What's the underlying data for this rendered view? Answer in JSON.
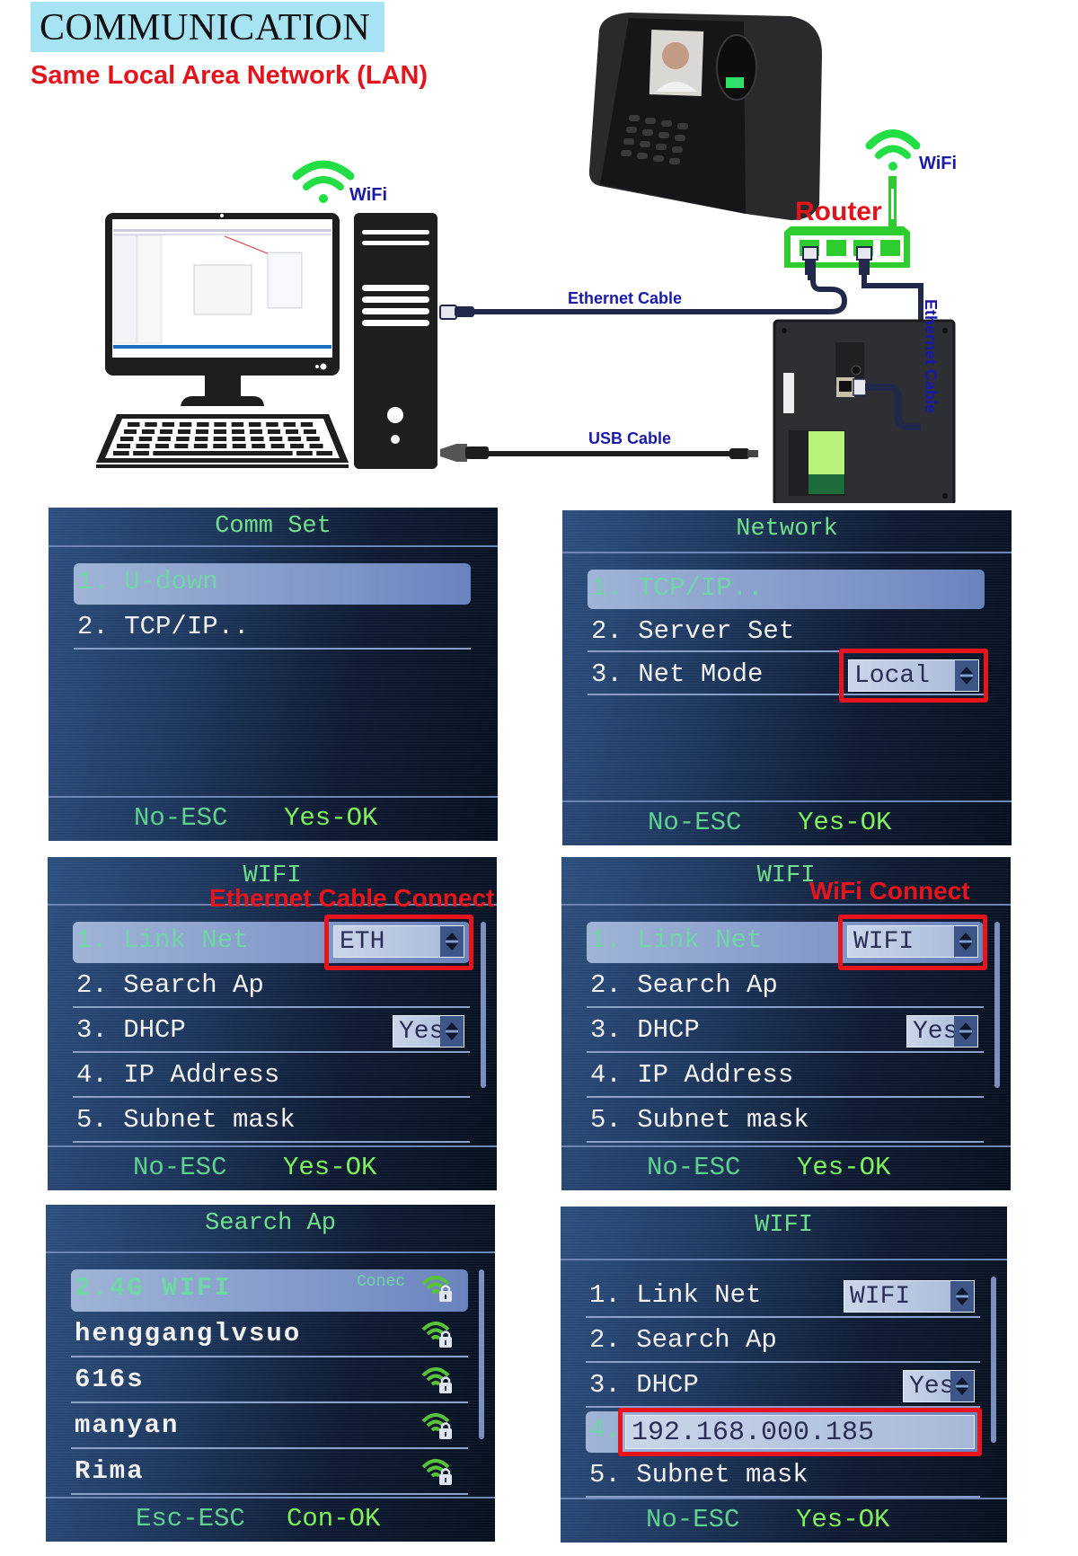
{
  "header": {
    "title": "COMMUNICATION",
    "subtitle": "Same Local Area Network (LAN)"
  },
  "diagram": {
    "pc_wifi_label": "WiFi",
    "router_wifi_label": "WiFi",
    "router_label": "Router",
    "ethernet_cable_label": "Ethernet Cable",
    "usb_cable_label": "USB Cable",
    "vertical_ethernet_label": "Ethernet Cable",
    "colors": {
      "wifi_green": "#22dd44",
      "router_green": "#2ecc2e",
      "cable_navy": "#22284a",
      "label_blue": "#1a1aa8",
      "label_red": "#e0141c",
      "title_bg": "#a6e3f3"
    }
  },
  "screens": [
    {
      "title": "Comm Set",
      "items": [
        {
          "label": "1. U-down",
          "selected": true
        },
        {
          "label": "2. TCP/IP..",
          "selected": false
        }
      ],
      "footer": {
        "left": "No-ESC",
        "right": "Yes-OK"
      }
    },
    {
      "title": "Network",
      "items": [
        {
          "label": "1. TCP/IP..",
          "selected": true
        },
        {
          "label": "2. Server Set",
          "selected": false
        },
        {
          "label": "3. Net Mode",
          "selected": false,
          "value": "Local",
          "highlighted": true
        }
      ],
      "footer": {
        "left": "No-ESC",
        "right": "Yes-OK"
      }
    },
    {
      "title": "WIFI",
      "annotation": "Ethernet Cable Connect",
      "items": [
        {
          "label": "1. Link Net",
          "selected": true,
          "value": "ETH",
          "highlighted": true
        },
        {
          "label": "2. Search Ap",
          "selected": false
        },
        {
          "label": "3. DHCP",
          "selected": false,
          "value": "Yes"
        },
        {
          "label": "4. IP Address",
          "selected": false
        },
        {
          "label": "5. Subnet mask",
          "selected": false
        }
      ],
      "footer": {
        "left": "No-ESC",
        "right": "Yes-OK"
      }
    },
    {
      "title": "WIFI",
      "annotation": "WiFi Connect",
      "items": [
        {
          "label": "1. Link Net",
          "selected": true,
          "value": "WIFI",
          "highlighted": true
        },
        {
          "label": "2. Search Ap",
          "selected": false
        },
        {
          "label": "3. DHCP",
          "selected": false,
          "value": "Yes"
        },
        {
          "label": "4. IP Address",
          "selected": false
        },
        {
          "label": "5. Subnet mask",
          "selected": false
        }
      ],
      "footer": {
        "left": "No-ESC",
        "right": "Yes-OK"
      }
    },
    {
      "title": "Search Ap",
      "items": [
        {
          "label": "2.4G WIFI",
          "selected": true,
          "status": "Conec",
          "icon": "wifi-lock-icon"
        },
        {
          "label": "hengganglvsuo",
          "selected": false,
          "icon": "wifi-lock-icon"
        },
        {
          "label": "616s",
          "selected": false,
          "icon": "wifi-lock-icon"
        },
        {
          "label": "manyan",
          "selected": false,
          "icon": "wifi-lock-icon"
        },
        {
          "label": "Rima",
          "selected": false,
          "icon": "wifi-lock-icon"
        }
      ],
      "footer": {
        "left": "Esc-ESC",
        "right": "Con-OK"
      }
    },
    {
      "title": "WIFI",
      "items": [
        {
          "label": "1. Link Net",
          "selected": false,
          "value": "WIFI"
        },
        {
          "label": "2. Search Ap",
          "selected": false
        },
        {
          "label": "3. DHCP",
          "selected": false,
          "value": "Yes"
        },
        {
          "label": "4.",
          "selected": true,
          "value": "192.168.000.185",
          "highlighted": true
        },
        {
          "label": "5. Subnet mask",
          "selected": false
        }
      ],
      "footer": {
        "left": "No-ESC",
        "right": "Yes-OK"
      }
    }
  ]
}
